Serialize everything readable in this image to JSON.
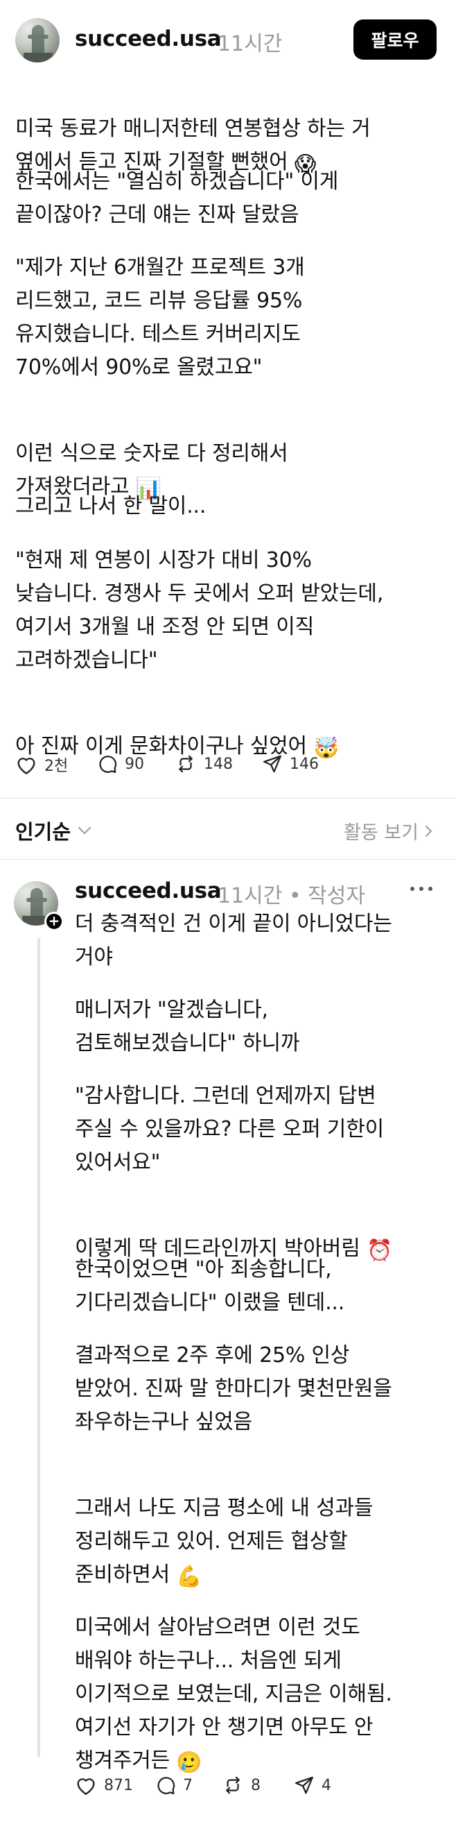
{
  "post": {
    "username": "succeed.usa",
    "time": "11시간",
    "follow_label": "팔로우",
    "paragraphs": [
      "미국 동료가 매니저한테 연봉협상 하는 거\n옆에서 듣고 진짜 기절할 뻔했어",
      "한국에서는 \"열심히 하겠습니다\" 이게\n끝이잖아? 근데 얘는 진짜 달랐음",
      "\"제가 지난 6개월간 프로젝트 3개\n리드했고, 코드 리뷰 응답률 95%\n유지했습니다. 테스트 커버리지도\n70%에서 90%로 올렸고요\"",
      "이런 식으로 숫자로 다 정리해서\n가져왔더라고",
      "그리고 나서 한 말이...",
      "\"현재 제 연봉이 시장가 대비 30%\n낮습니다. 경쟁사 두 곳에서 오퍼 받았는데,\n여기서 3개월 내 조정 안 되면 이직\n고려하겠습니다\"",
      "아 진짜 이게 문화차이구나 싶었어"
    ],
    "emojis": [
      "😱",
      "📊",
      "🤯"
    ],
    "likes": "2천",
    "comments": "90",
    "reposts": "148",
    "shares": "146"
  },
  "sort": {
    "label": "인기순",
    "activity_label": "활동 보기"
  },
  "reply": {
    "username": "succeed.usa",
    "time_author": "11시간 • 작성자",
    "paragraphs": [
      "더 충격적인 건 이게 끝이 아니었다는\n거야",
      "매니저가 \"알겠습니다,\n검토해보겠습니다\" 하니까",
      "\"감사합니다. 그런데 언제까지 답변\n주실 수 있을까요? 다른 오퍼 기한이\n있어서요\"",
      "이렇게 딱 데드라인까지 박아버림",
      "한국이었으면 \"아 죄송합니다,\n기다리겠습니다\" 이랬을 텐데...",
      "결과적으로 2주 후에 25% 인상\n받았어. 진짜 말 한마디가 몇천만원을\n좌우하는구나 싶었음",
      "그래서 나도 지금 평소에 내 성과들\n정리해두고 있어. 언제든 협상할\n준비하면서",
      "미국에서 살아남으려면 이런 것도\n배워야 하는구나... 처음엔 되게\n이기적으로 보였는데, 지금은 이해됨.\n여기선 자기가 안 챙기면 아무도 안\n챙겨주거든"
    ],
    "emojis": [
      "⏰",
      "💪",
      "🥲"
    ],
    "likes": "871",
    "comments": "7",
    "reposts": "8",
    "shares": "4"
  }
}
